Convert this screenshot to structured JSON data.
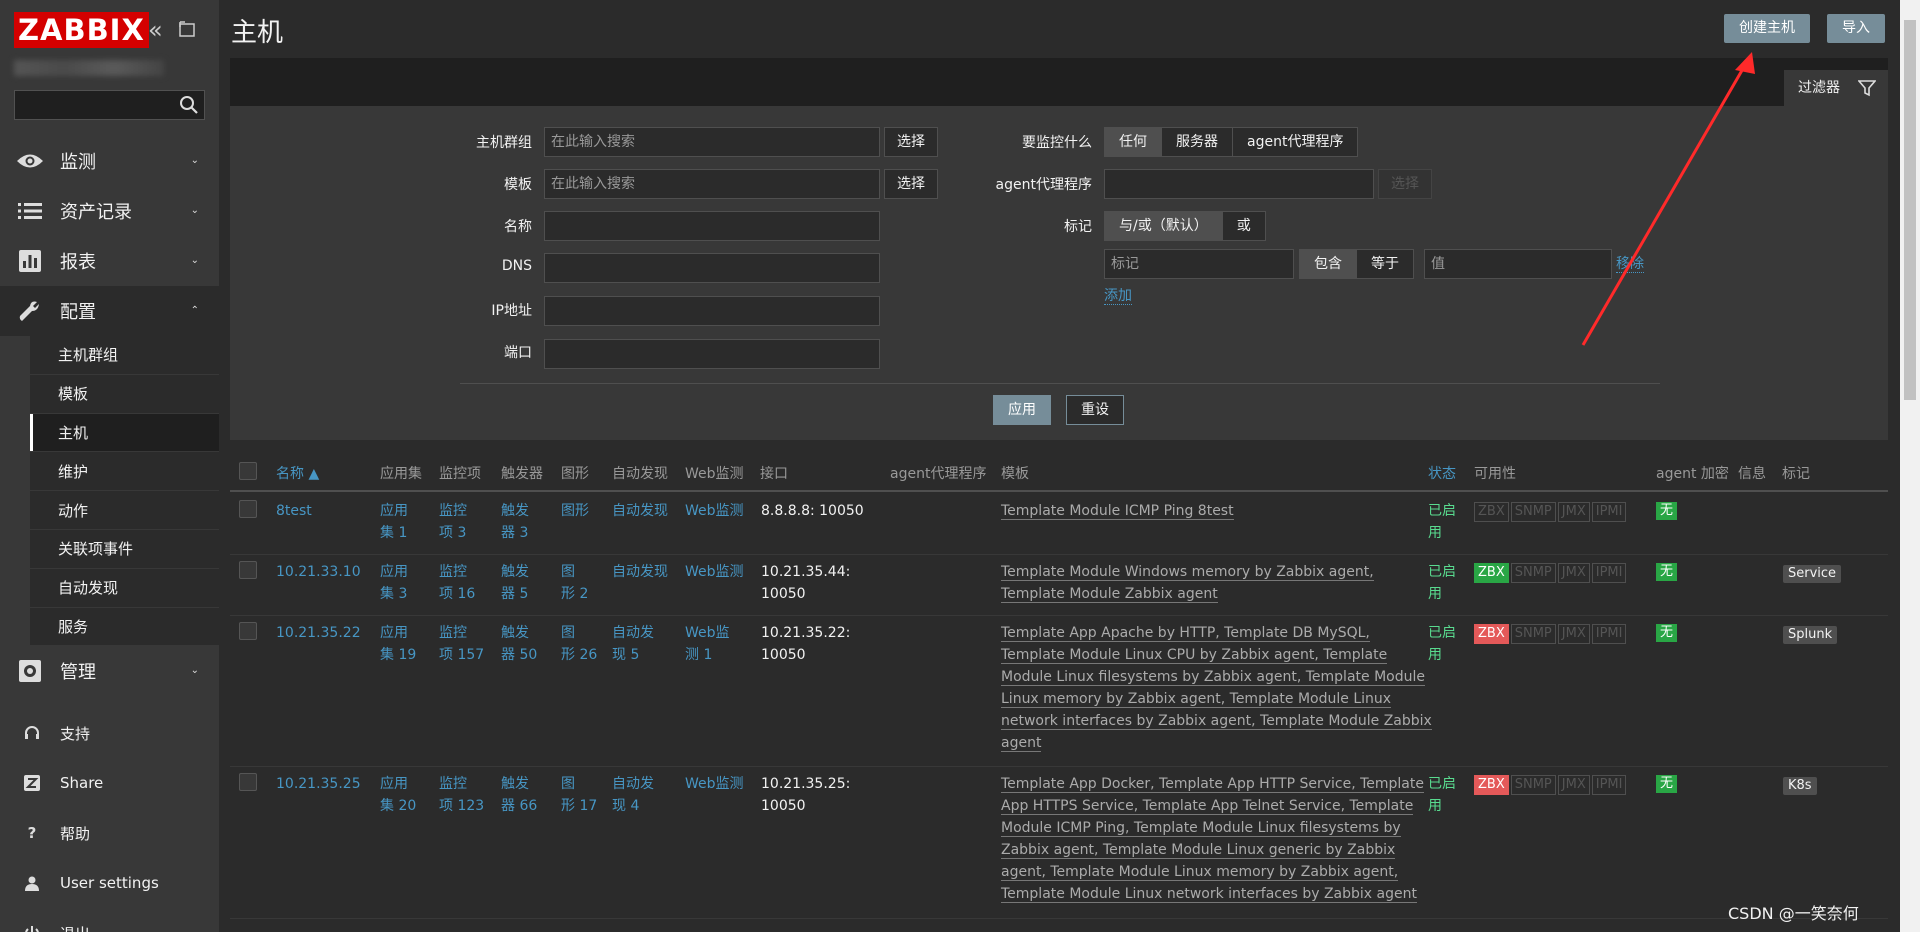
{
  "app": {
    "logo": "ZABBIX"
  },
  "sidebar": {
    "menu": [
      {
        "label": "监测",
        "icon": "eye-icon"
      },
      {
        "label": "资产记录",
        "icon": "list-icon"
      },
      {
        "label": "报表",
        "icon": "bar-chart-icon"
      },
      {
        "label": "配置",
        "icon": "wrench-icon"
      }
    ],
    "submenu": [
      "主机群组",
      "模板",
      "主机",
      "维护",
      "动作",
      "关联项事件",
      "自动发现",
      "服务"
    ],
    "admin": {
      "label": "管理",
      "icon": "gear-icon"
    },
    "bottom": [
      {
        "label": "支持",
        "icon": "headset-icon"
      },
      {
        "label": "Share",
        "icon": "share-icon"
      },
      {
        "label": "帮助",
        "icon": "help-icon"
      },
      {
        "label": "User settings",
        "icon": "user-icon"
      },
      {
        "label": "退出",
        "icon": "logout-icon"
      }
    ]
  },
  "header": {
    "title": "主机",
    "create_label": "创建主机",
    "import_label": "导入"
  },
  "filter": {
    "tab_label": "过滤器",
    "host_groups_label": "主机群组",
    "templates_label": "模板",
    "name_label": "名称",
    "dns_label": "DNS",
    "ip_label": "IP地址",
    "port_label": "端口",
    "search_placeholder": "在此输入搜索",
    "select_label": "选择",
    "monitored_by_label": "要监控什么",
    "monitored_by_options": [
      "任何",
      "服务器",
      "agent代理程序"
    ],
    "proxy_label": "agent代理程序",
    "tags_label": "标记",
    "tags_op": [
      "与/或（默认）",
      "或"
    ],
    "tag_placeholder": "标记",
    "tag_ops": [
      "包含",
      "等于"
    ],
    "value_placeholder": "值",
    "remove_label": "移除",
    "add_label": "添加",
    "apply_label": "应用",
    "reset_label": "重设"
  },
  "table": {
    "headers": [
      "名称 ▲",
      "应用集",
      "监控项",
      "触发器",
      "图形",
      "自动发现",
      "Web监测",
      "接口",
      "agent代理程序",
      "模板",
      "状态",
      "可用性",
      "agent 加密",
      "信息",
      "标记"
    ],
    "availability_labels": [
      "ZBX",
      "SNMP",
      "JMX",
      "IPMI"
    ],
    "encryption_label": "无",
    "rows": [
      {
        "name": "8test",
        "apps": [
          "应用",
          "集 1"
        ],
        "items": [
          "监控",
          "项 3"
        ],
        "triggers": [
          "触发",
          "器 3"
        ],
        "graphs": [
          "图形",
          ""
        ],
        "discovery": [
          "自动发现",
          ""
        ],
        "web": [
          "Web监测",
          ""
        ],
        "iface": [
          "8.8.8.8: 10050",
          ""
        ],
        "templates": [
          "Template Module ICMP Ping 8test"
        ],
        "status": [
          "已启",
          "用"
        ],
        "zbx": "none",
        "tag": ""
      },
      {
        "name": "10.21.33.10",
        "apps": [
          "应用",
          "集 3"
        ],
        "items": [
          "监控",
          "项 16"
        ],
        "triggers": [
          "触发",
          "器 5"
        ],
        "graphs": [
          "图",
          "形 2"
        ],
        "discovery": [
          "自动发现",
          ""
        ],
        "web": [
          "Web监测",
          ""
        ],
        "iface": [
          "10.21.35.44:",
          "10050"
        ],
        "templates": [
          "Template Module Windows memory by Zabbix agent,",
          "Template Module Zabbix agent"
        ],
        "status": [
          "已启",
          "用"
        ],
        "zbx": "ok",
        "tag": "Service"
      },
      {
        "name": "10.21.35.22",
        "apps": [
          "应用",
          "集 19"
        ],
        "items": [
          "监控",
          "项 157"
        ],
        "triggers": [
          "触发",
          "器 50"
        ],
        "graphs": [
          "图",
          "形 26"
        ],
        "discovery": [
          "自动发",
          "现 5"
        ],
        "web": [
          "Web监",
          "测 1"
        ],
        "iface": [
          "10.21.35.22:",
          "10050"
        ],
        "templates": [
          "Template App Apache by HTTP, Template DB MySQL,",
          "Template Module Linux CPU by Zabbix agent, Template",
          "Module Linux filesystems by Zabbix agent, Template Module",
          "Linux memory by Zabbix agent, Template Module Linux",
          "network interfaces by Zabbix agent, Template Module Zabbix",
          "agent"
        ],
        "status": [
          "已启",
          "用"
        ],
        "zbx": "bad",
        "tag": "Splunk"
      },
      {
        "name": "10.21.35.25",
        "apps": [
          "应用",
          "集 20"
        ],
        "items": [
          "监控",
          "项 123"
        ],
        "triggers": [
          "触发",
          "器 66"
        ],
        "graphs": [
          "图",
          "形 17"
        ],
        "discovery": [
          "自动发",
          "现 4"
        ],
        "web": [
          "Web监测",
          ""
        ],
        "iface": [
          "10.21.35.25:",
          "10050"
        ],
        "templates": [
          "Template App Docker, Template App HTTP Service, Template",
          "App HTTPS Service, Template App Telnet Service, Template",
          "Module ICMP Ping, Template Module Linux filesystems by",
          "Zabbix agent, Template Module Linux generic by Zabbix",
          "agent, Template Module Linux memory by Zabbix agent,",
          "Template Module Linux network interfaces by Zabbix agent"
        ],
        "status": [
          "已启",
          "用"
        ],
        "zbx": "bad",
        "tag": "K8s"
      }
    ]
  },
  "watermark": "CSDN @一笑奈何",
  "colors": {
    "accent": "#4796c4",
    "button": "#768d99",
    "ok": "#29a645",
    "bad": "#e45959",
    "enabled": "#59db8f",
    "arrow": "#ff2a2a"
  }
}
